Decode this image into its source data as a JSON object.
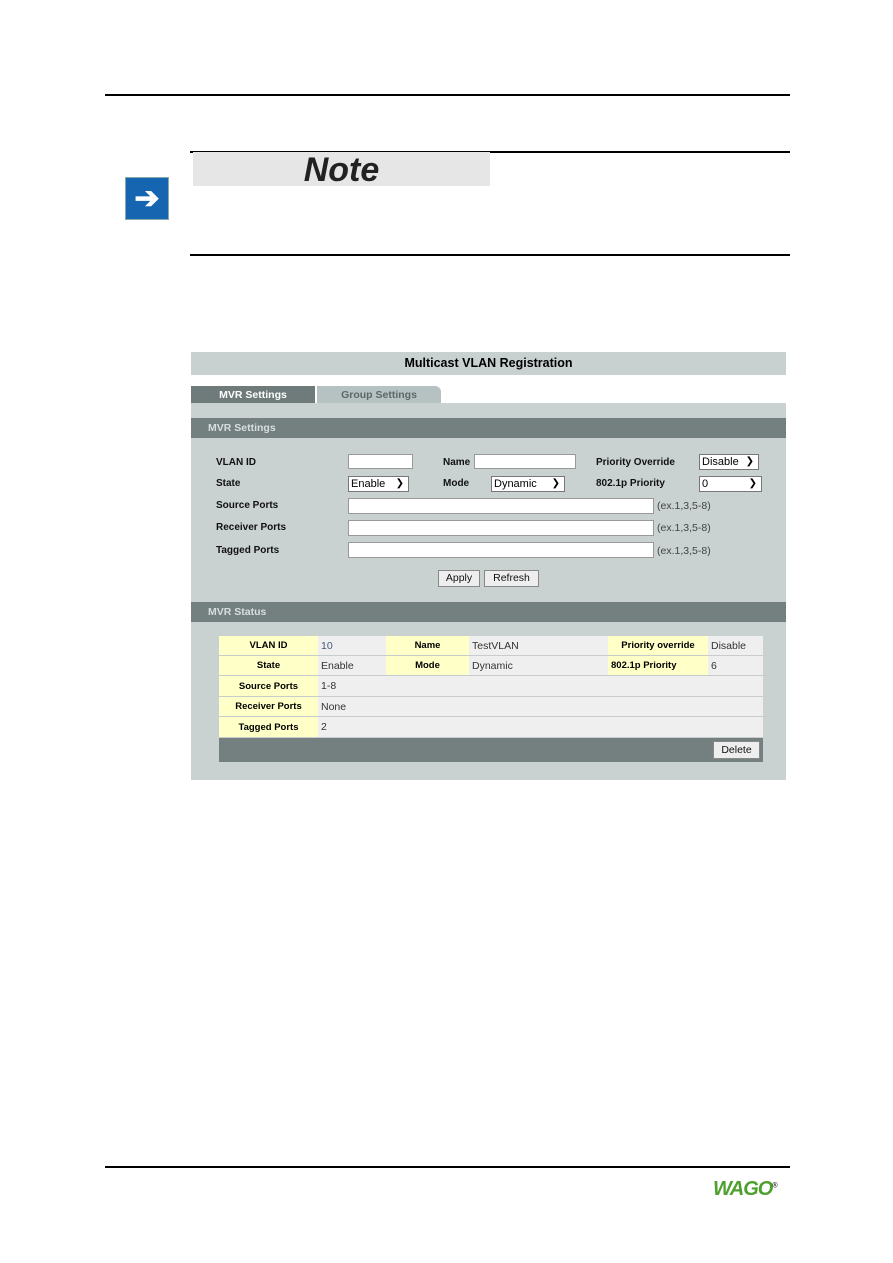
{
  "note": {
    "title": "Note",
    "icon": "arrow-right-icon"
  },
  "ui": {
    "title": "Multicast VLAN Registration",
    "tabs": [
      "MVR Settings",
      "Group Settings"
    ],
    "settings": {
      "header": "MVR Settings",
      "vlan_id_label": "VLAN ID",
      "vlan_id_value": "",
      "name_label": "Name",
      "name_value": "",
      "priority_override_label": "Priority Override",
      "priority_override_value": "Disable",
      "state_label": "State",
      "state_value": "Enable",
      "mode_label": "Mode",
      "mode_value": "Dynamic",
      "priority_label": "802.1p Priority",
      "priority_value": "0",
      "source_label": "Source Ports",
      "receiver_label": "Receiver Ports",
      "tagged_label": "Tagged Ports",
      "hint": "(ex.1,3,5-8)",
      "apply": "Apply",
      "refresh": "Refresh"
    },
    "status": {
      "header": "MVR Status",
      "vlan_id_label": "VLAN ID",
      "vlan_id": "10",
      "name_label": "Name",
      "name": "TestVLAN",
      "priority_override_label": "Priority override",
      "priority_override": "Disable",
      "state_label": "State",
      "state": "Enable",
      "mode_label": "Mode",
      "mode": "Dynamic",
      "priority_label": "802.1p Priority",
      "priority": "6",
      "source_label": "Source Ports",
      "source": "1-8",
      "receiver_label": "Receiver Ports",
      "receiver": "None",
      "tagged_label": "Tagged Ports",
      "tagged": "2",
      "delete": "Delete"
    }
  },
  "footer": {
    "logo": "WAGO"
  },
  "colors": {
    "accent_blue": "#1565b0",
    "header_gray": "#748080",
    "key_yellow": "#ffffc8",
    "logo_green": "#4ea02e"
  }
}
